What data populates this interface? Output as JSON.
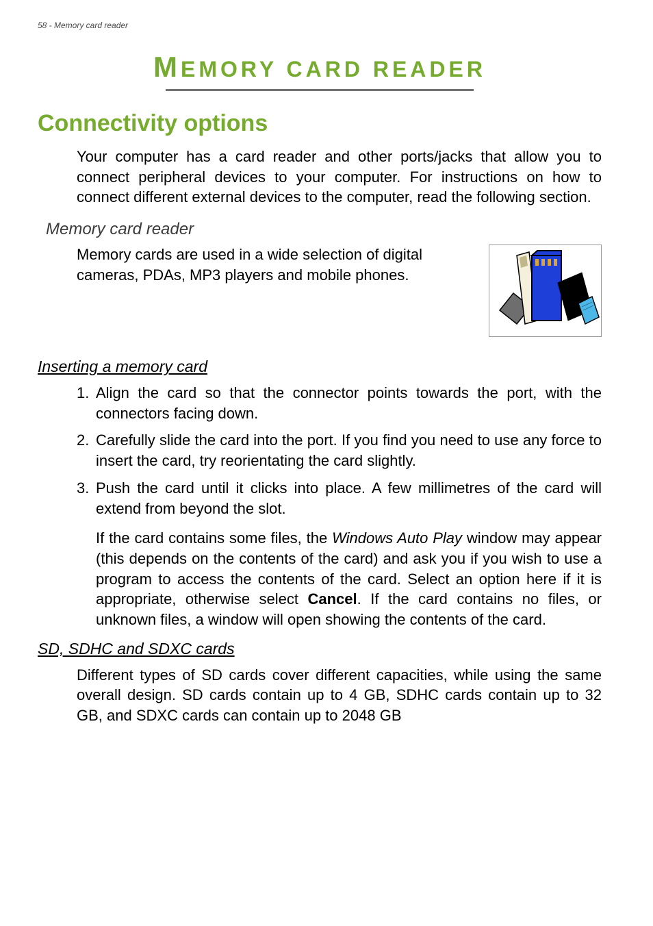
{
  "header": {
    "page_label": "58 - Memory card reader"
  },
  "title": {
    "big_letter": "M",
    "rest": "EMORY CARD READER"
  },
  "section": {
    "heading": "Connectivity options",
    "intro": "Your computer has a card reader and other ports/jacks that allow you to connect peripheral devices to your computer. For instructions on how to connect different external devices to the computer, read the following section."
  },
  "memory_card": {
    "heading": "Memory card reader",
    "text": "Memory cards are used in a wide selection of digital cameras, PDAs, MP3 players and mobile phones."
  },
  "inserting": {
    "heading": "Inserting a memory card",
    "steps": [
      "Align the card so that the connector points towards the port, with the connectors facing down.",
      "Carefully slide the card into the port. If you find you need to use any force to insert the card, try reorientating the card slightly.",
      "Push the card until it clicks into place. A few millimetres of the card will extend from beyond the slot."
    ],
    "note_prefix": "If the card contains some files, the ",
    "note_italic": "Windows Auto Play",
    "note_mid": " window may appear (this depends on the contents of the card) and ask you if you wish to use a program to access the contents of the card. Select an option here if it is appropriate, otherwise select ",
    "note_bold": "Cancel",
    "note_suffix": ". If the card contains no files, or unknown files, a window will open showing the contents of the card."
  },
  "sd_cards": {
    "heading": "SD, SDHC and SDXC cards",
    "text": "Different types of SD cards cover different capacities, while using the same overall design. SD cards contain up to 4 GB, SDHC cards contain up to 32 GB, and SDXC cards can contain up to 2048 GB"
  }
}
